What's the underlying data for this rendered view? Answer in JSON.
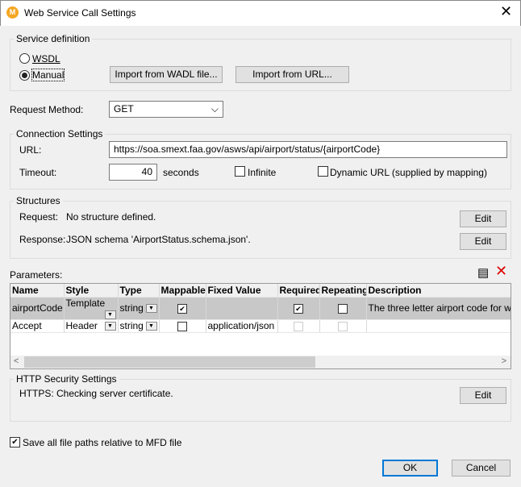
{
  "window": {
    "title": "Web Service Call Settings"
  },
  "service_definition": {
    "label": "Service definition",
    "wsdl": "WSDL",
    "manual": "Manual",
    "selected": "Manual",
    "import_wadl": "Import from WADL file...",
    "import_url": "Import from URL..."
  },
  "request_method": {
    "label": "Request Method:",
    "value": "GET"
  },
  "connection": {
    "label": "Connection Settings",
    "url_label": "URL:",
    "url": "https://soa.smext.faa.gov/asws/api/airport/status/{airportCode}",
    "timeout_label": "Timeout:",
    "timeout": "40",
    "seconds": "seconds",
    "infinite": "Infinite",
    "infinite_checked": false,
    "dynamic_url": "Dynamic URL (supplied by mapping)",
    "dynamic_checked": false
  },
  "structures": {
    "label": "Structures",
    "request_label": "Request:",
    "request_value": "No structure defined.",
    "response_label": "Response:",
    "response_value": "JSON schema 'AirportStatus.schema.json'.",
    "edit": "Edit"
  },
  "parameters": {
    "label": "Parameters:",
    "columns": [
      "Name",
      "Style",
      "Type",
      "Mappable",
      "Fixed Value",
      "Required",
      "Repeating",
      "Description"
    ],
    "rows": [
      {
        "name": "airportCode",
        "style": "Template",
        "type": "string",
        "mappable": true,
        "fixed": "",
        "required": true,
        "repeating": false,
        "description": "The three letter airport code for w"
      },
      {
        "name": "Accept",
        "style": "Header",
        "type": "string",
        "mappable": false,
        "fixed": "application/json",
        "required": false,
        "repeating": false,
        "description": ""
      }
    ]
  },
  "http_security": {
    "label": "HTTP Security Settings",
    "text": "HTTPS: Checking server certificate.",
    "edit": "Edit"
  },
  "save_paths": {
    "label": "Save all file paths relative to MFD file",
    "checked": true
  },
  "buttons": {
    "ok": "OK",
    "cancel": "Cancel"
  }
}
